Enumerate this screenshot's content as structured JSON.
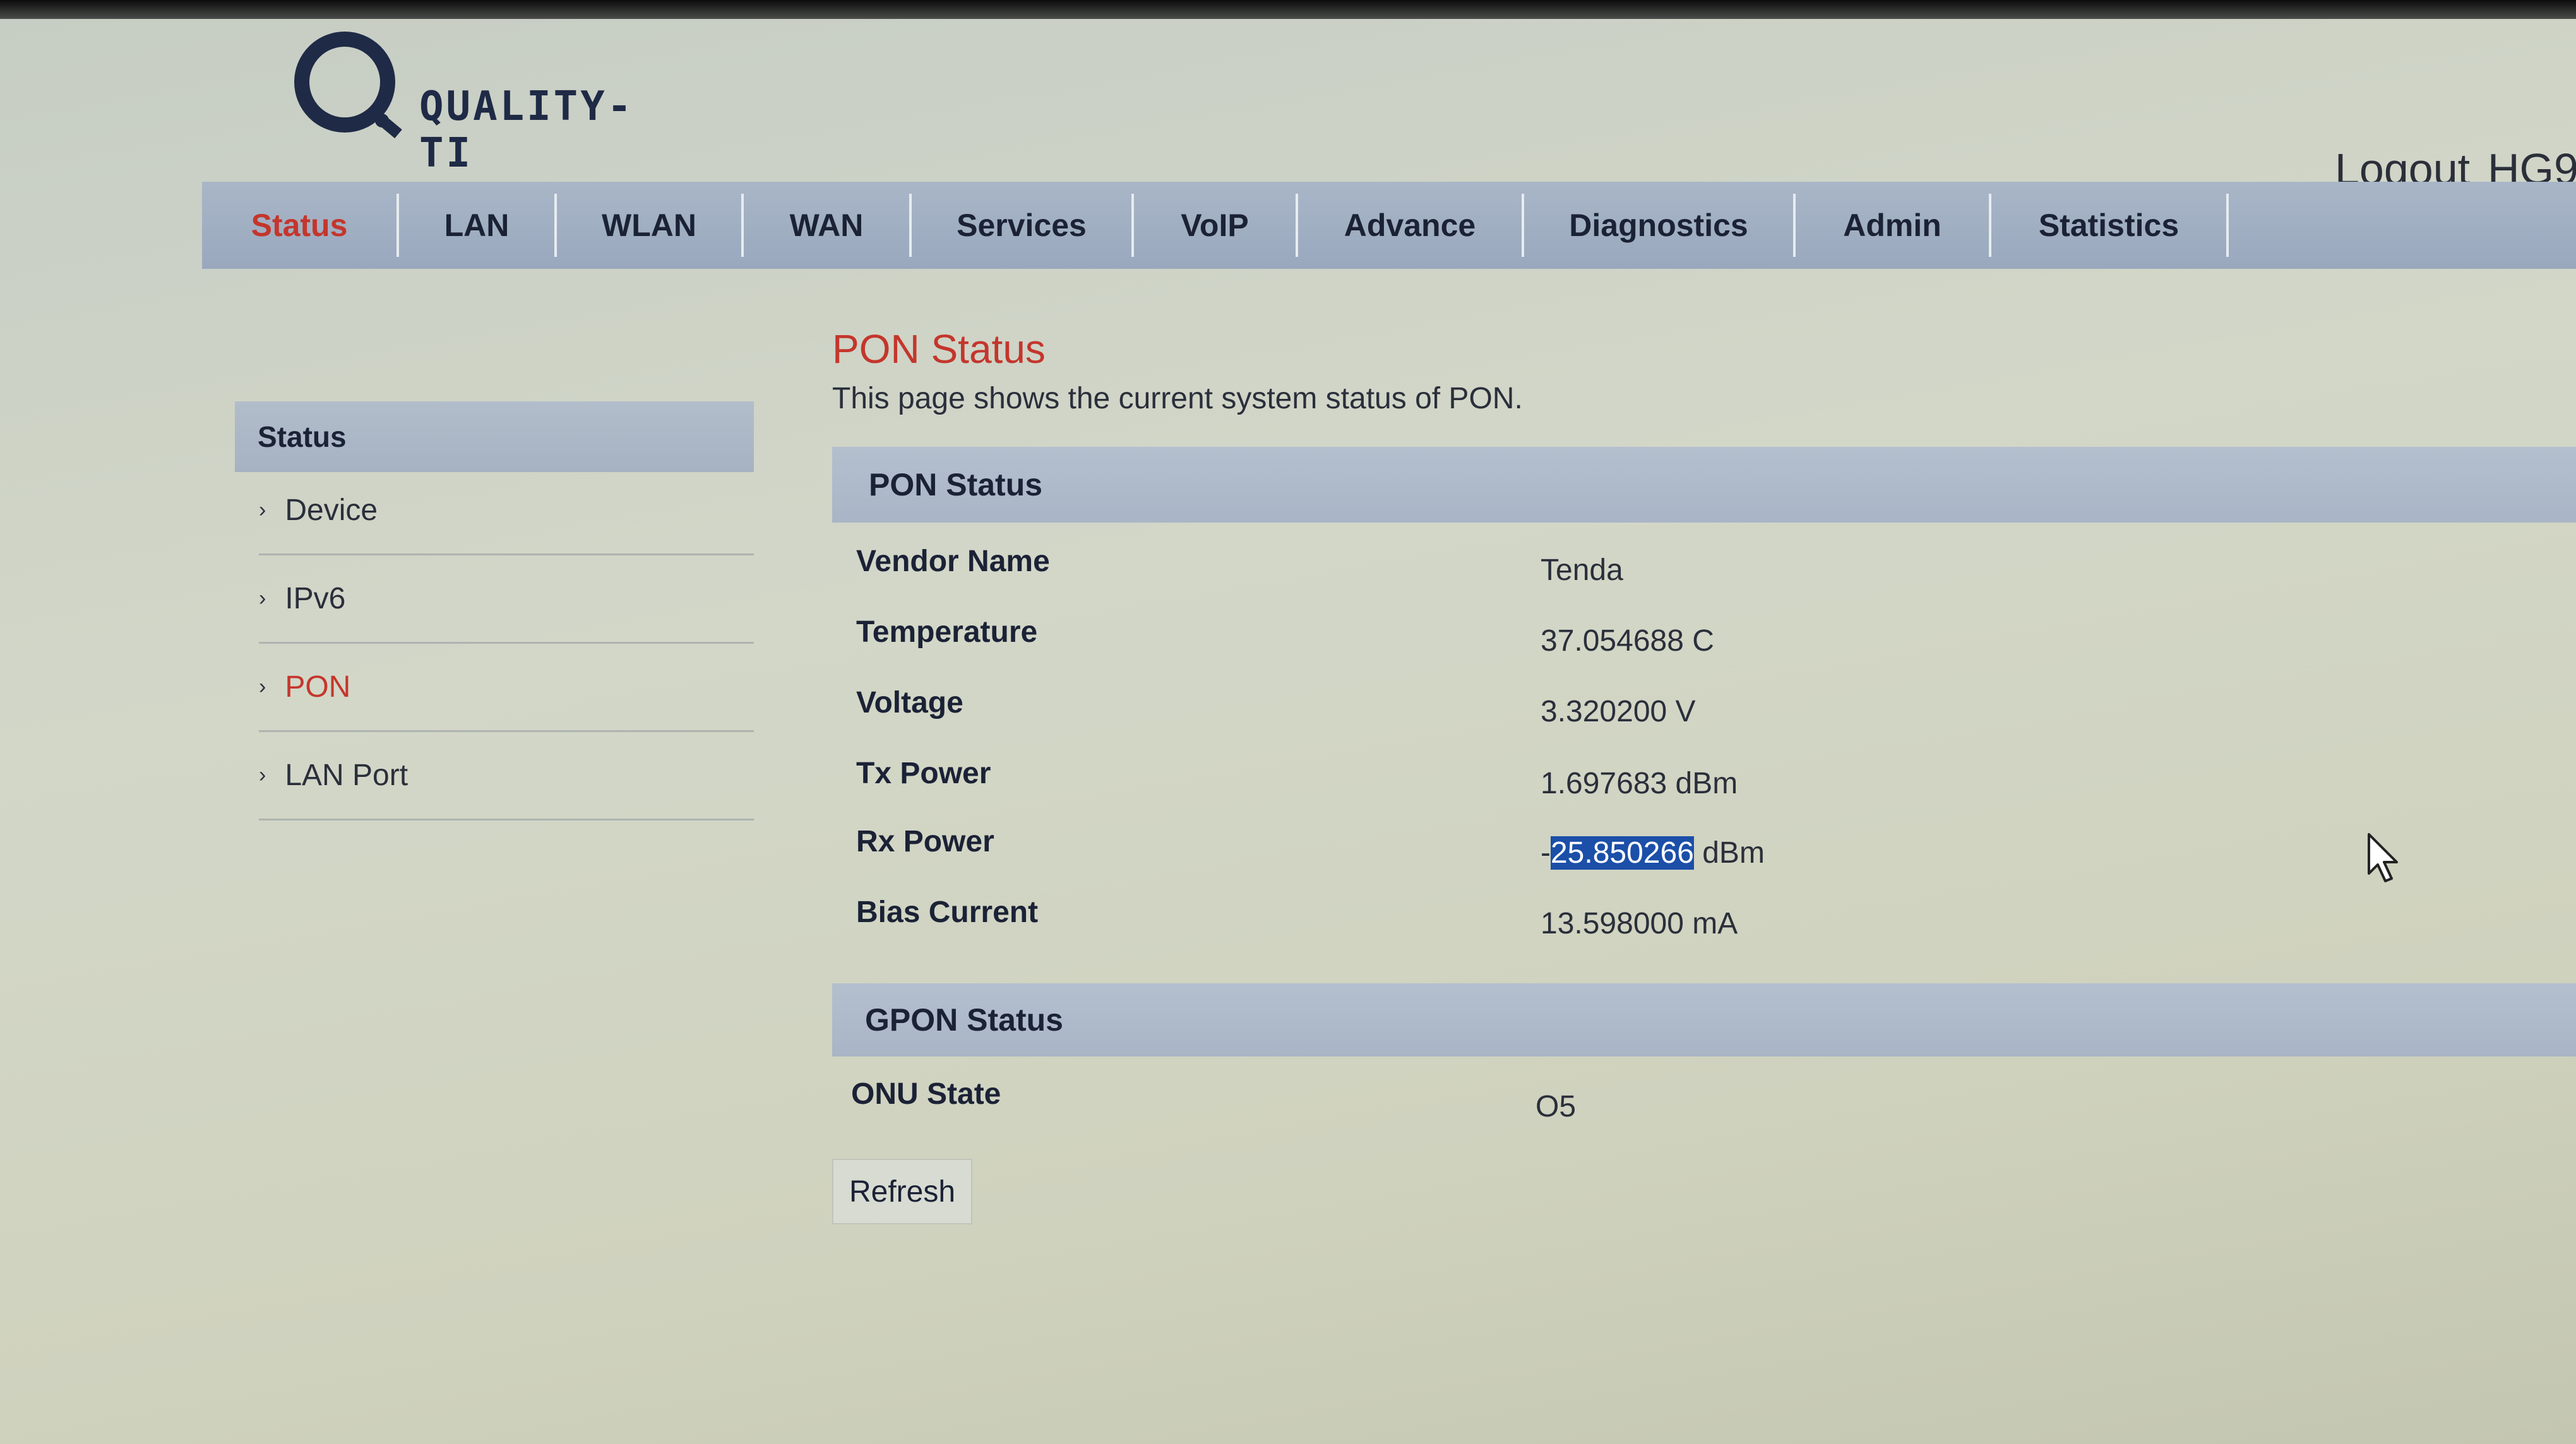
{
  "brand": {
    "logo_text": "QUALITY-TI"
  },
  "header": {
    "logout_label": "Logout",
    "model_text": "HG9"
  },
  "nav": {
    "items": [
      {
        "label": "Status",
        "active": true
      },
      {
        "label": "LAN"
      },
      {
        "label": "WLAN"
      },
      {
        "label": "WAN"
      },
      {
        "label": "Services"
      },
      {
        "label": "VoIP"
      },
      {
        "label": "Advance"
      },
      {
        "label": "Diagnostics"
      },
      {
        "label": "Admin"
      },
      {
        "label": "Statistics"
      }
    ]
  },
  "sidebar": {
    "heading": "Status",
    "items": [
      {
        "label": "Device"
      },
      {
        "label": "IPv6"
      },
      {
        "label": "PON",
        "active": true
      },
      {
        "label": "LAN Port"
      }
    ]
  },
  "main": {
    "title": "PON Status",
    "description": "This page shows the current system status of PON.",
    "pon_section": {
      "heading": "PON Status",
      "rows": [
        {
          "label": "Vendor Name",
          "value": "Tenda"
        },
        {
          "label": "Temperature",
          "value": "37.054688 C"
        },
        {
          "label": "Voltage",
          "value": "3.320200 V"
        },
        {
          "label": "Tx Power",
          "value": "1.697683 dBm"
        },
        {
          "label": "Rx Power",
          "value_prefix": "-",
          "value_selected": "25.850266",
          "value_suffix": " dBm"
        },
        {
          "label": "Bias Current",
          "value": "13.598000 mA"
        }
      ]
    },
    "gpon_section": {
      "heading": "GPON Status",
      "rows": [
        {
          "label": "ONU State",
          "value": "O5"
        }
      ]
    },
    "refresh_label": "Refresh"
  },
  "colors": {
    "accent_red": "#c4362c",
    "nav_blue": "#a9b6c8",
    "selection_blue": "#1b4fa8",
    "text_dark": "#1b2236"
  }
}
